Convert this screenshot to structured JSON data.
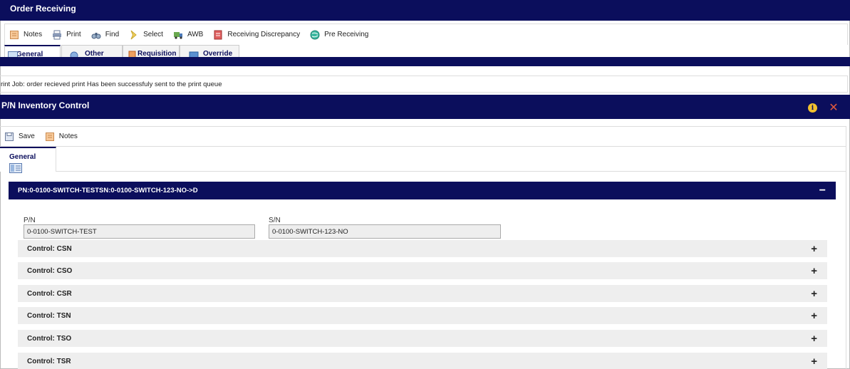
{
  "window": {
    "title": "Order Receiving"
  },
  "toolbar": {
    "items": [
      {
        "label": "Notes",
        "icon": "notes-icon"
      },
      {
        "label": "Print",
        "icon": "print-icon"
      },
      {
        "label": "Find",
        "icon": "binoculars-icon"
      },
      {
        "label": "Select",
        "icon": "select-chevron-icon"
      },
      {
        "label": "AWB",
        "icon": "truck-icon"
      },
      {
        "label": "Receiving Discrepancy",
        "icon": "discrepancy-icon"
      },
      {
        "label": "Pre Receiving",
        "icon": "globe-icon"
      }
    ]
  },
  "tabs": [
    {
      "label": "General",
      "active": true
    },
    {
      "label": "Other",
      "active": false
    },
    {
      "label": "Requisition",
      "active": false
    },
    {
      "label": "Override",
      "active": false
    }
  ],
  "message": {
    "text": "rint Job: order recieved print Has been successfuly sent to the print queue"
  },
  "dialog": {
    "title": "P/N Inventory Control",
    "toolbar": [
      {
        "label": "Save",
        "icon": "save-icon"
      },
      {
        "label": "Notes",
        "icon": "notes-icon"
      }
    ],
    "tab": {
      "label": "General"
    },
    "panel": {
      "header": "PN:0-0100-SWITCH-TESTSN:0-0100-SWITCH-123-NO->D",
      "collapse_symbol": "−",
      "fields": {
        "pn": {
          "label": "P/N",
          "value": "0-0100-SWITCH-TEST"
        },
        "sn": {
          "label": "S/N",
          "value": "0-0100-SWITCH-123-NO"
        }
      },
      "sections": [
        {
          "label": "Control: CSN",
          "expand_symbol": "+"
        },
        {
          "label": "Control: CSO",
          "expand_symbol": "+"
        },
        {
          "label": "Control: CSR",
          "expand_symbol": "+"
        },
        {
          "label": "Control: TSN",
          "expand_symbol": "+"
        },
        {
          "label": "Control: TSO",
          "expand_symbol": "+"
        },
        {
          "label": "Control: TSR",
          "expand_symbol": "+"
        }
      ]
    },
    "info_icon_glyph": "i",
    "close_icon_glyph": "✕"
  },
  "colors": {
    "nav": "#0b0e5c",
    "close": "#e05a3c",
    "info": "#f2c12e",
    "section_bg": "#eeeeee"
  }
}
